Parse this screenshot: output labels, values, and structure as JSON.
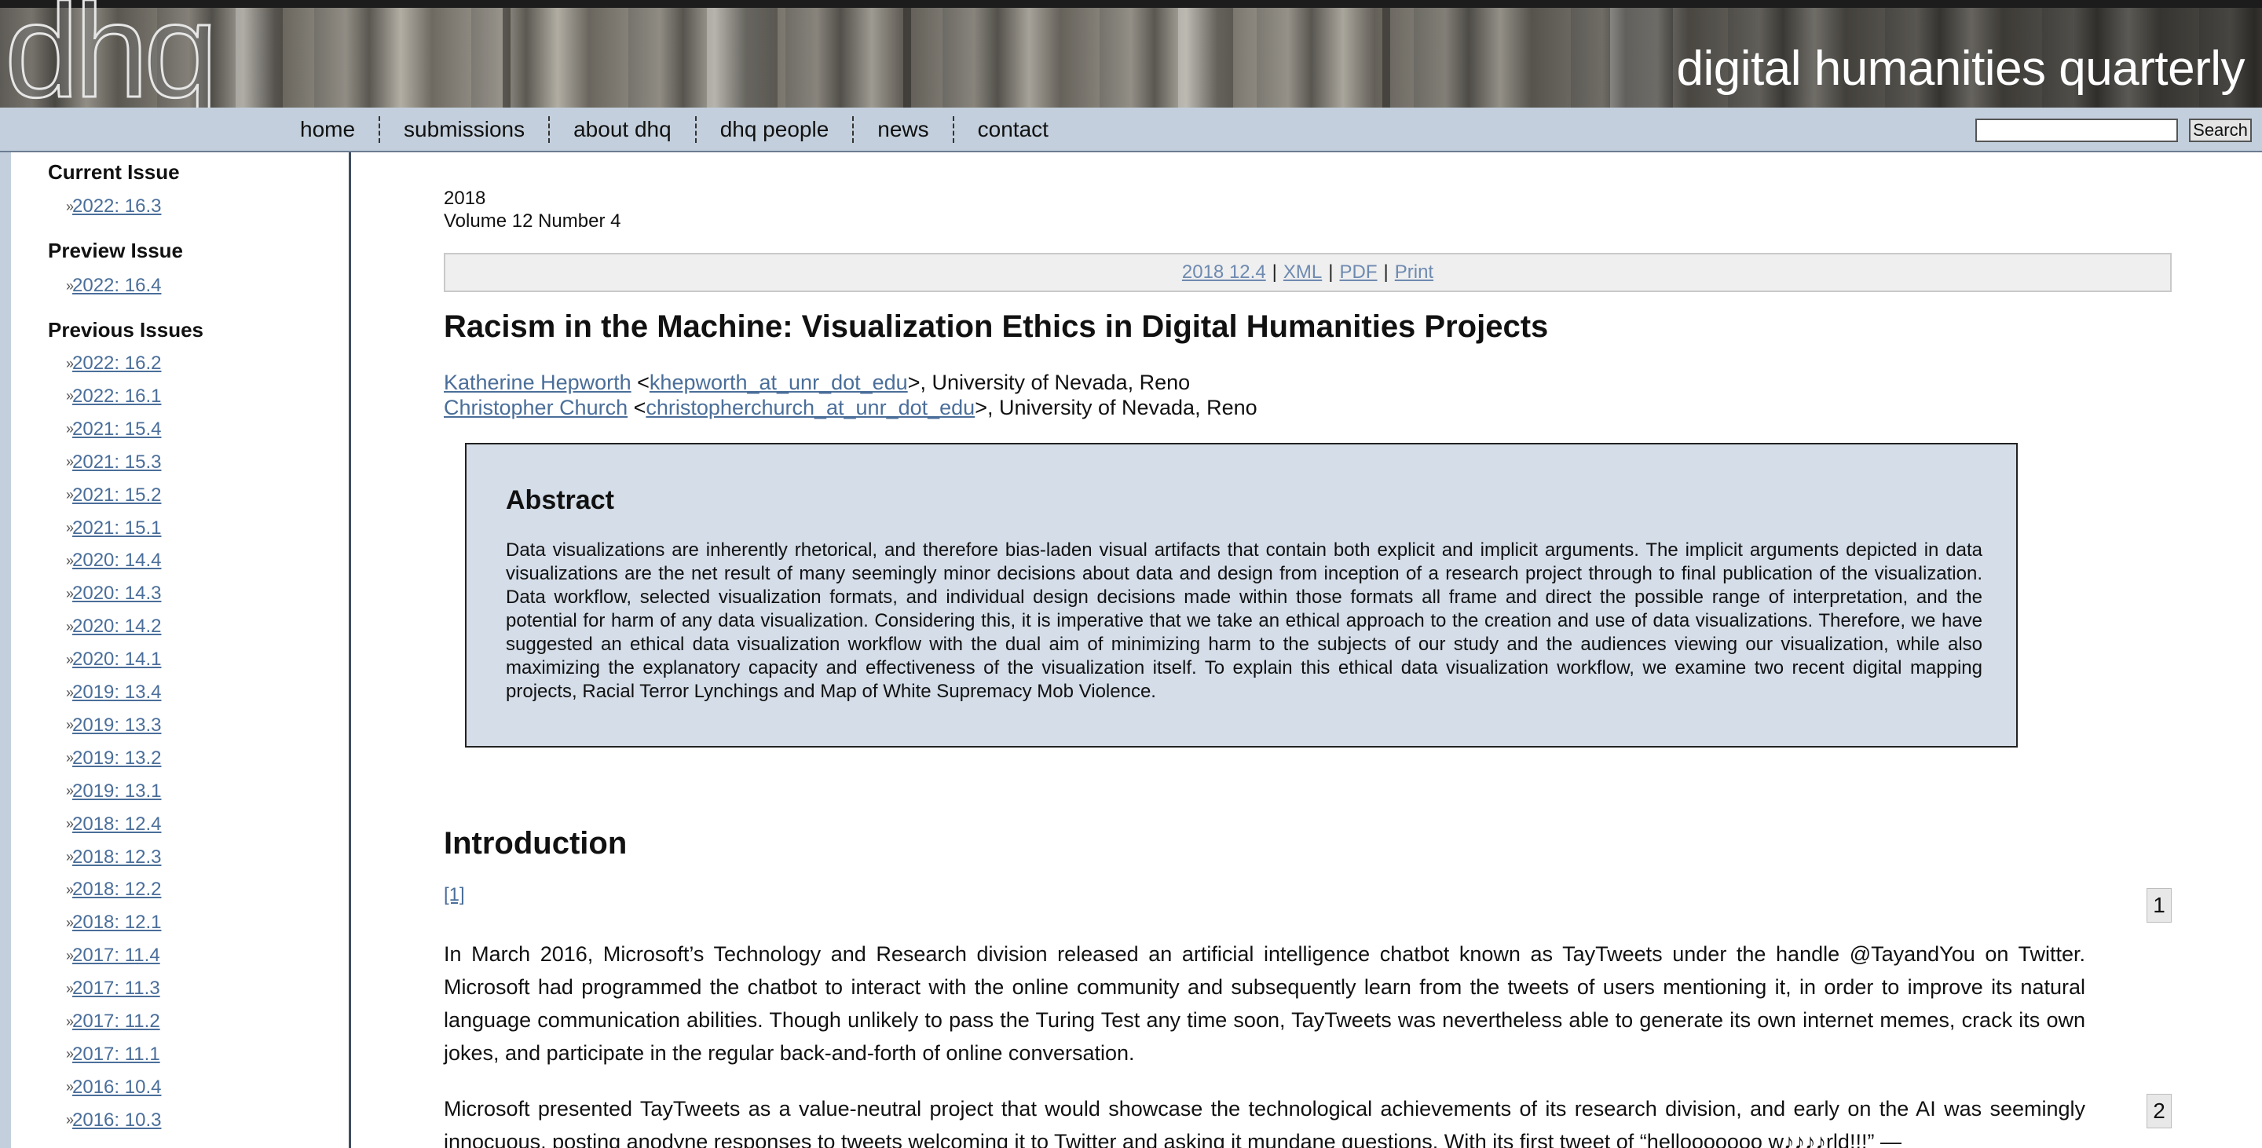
{
  "banner": {
    "logo": "dhq",
    "site_title": "digital humanities quarterly"
  },
  "nav": {
    "links": [
      "home",
      "submissions",
      "about dhq",
      "dhq people",
      "news",
      "contact"
    ],
    "search_placeholder": "",
    "search_button": "Search"
  },
  "sidebar": {
    "current_heading": "Current Issue",
    "current": "2022: 16.3",
    "preview_heading": "Preview Issue",
    "preview": "2022: 16.4",
    "previous_heading": "Previous Issues",
    "previous": [
      "2022: 16.2",
      "2022: 16.1",
      "2021: 15.4",
      "2021: 15.3",
      "2021: 15.2",
      "2021: 15.1",
      "2020: 14.4",
      "2020: 14.3",
      "2020: 14.2",
      "2020: 14.1",
      "2019: 13.4",
      "2019: 13.3",
      "2019: 13.2",
      "2019: 13.1",
      "2018: 12.4",
      "2018: 12.3",
      "2018: 12.2",
      "2018: 12.1",
      "2017: 11.4",
      "2017: 11.3",
      "2017: 11.2",
      "2017: 11.1",
      "2016: 10.4",
      "2016: 10.3"
    ]
  },
  "article": {
    "year": "2018",
    "volume": "Volume 12 Number 4",
    "toolbar": {
      "issue": "2018 12.4",
      "xml": "XML",
      "pdf": "PDF",
      "print": "Print"
    },
    "title": "Racism in the Machine: Visualization Ethics in Digital Humanities Projects",
    "authors": [
      {
        "name": "Katherine Hepworth",
        "email": "khepworth_at_unr_dot_edu",
        "affiliation": ", University of Nevada, Reno"
      },
      {
        "name": "Christopher Church",
        "email": "christopherchurch_at_unr_dot_edu",
        "affiliation": ", University of Nevada, Reno"
      }
    ],
    "abstract_heading": "Abstract",
    "abstract_text": "Data visualizations are inherently rhetorical, and therefore bias-laden visual artifacts that contain both explicit and implicit arguments. The implicit arguments depicted in data visualizations are the net result of many seemingly minor decisions about data and design from inception of a research project through to final publication of the visualization. Data workflow, selected visualization formats, and individual design decisions made within those formats all frame and direct the possible range of interpretation, and the potential for harm of any data visualization. Considering this, it is imperative that we take an ethical approach to the creation and use of data visualizations. Therefore, we have suggested an ethical data visualization workflow with the dual aim of minimizing harm to the subjects of our study and the audiences viewing our visualization, while also maximizing the explanatory capacity and effectiveness of the visualization itself. To explain this ethical data visualization workflow, we examine two recent digital mapping projects, Racial Terror Lynchings and Map of White Supremacy Mob Violence.",
    "intro_heading": "Introduction",
    "footnote_ref": "[1]",
    "paragraphs": [
      {
        "num": "1",
        "text": "In March 2016, Microsoft’s Technology and Research division released an artificial intelligence chatbot known as TayTweets under the handle @TayandYou on Twitter. Microsoft had programmed the chatbot to interact with the online community and subsequently learn from the tweets of users mentioning it, in order to improve its natural language communication abilities. Though unlikely to pass the Turing Test any time soon, TayTweets was nevertheless able to generate its own internet memes, crack its own jokes, and participate in the regular back-and-forth of online conversation."
      },
      {
        "num": "2",
        "text": "Microsoft presented TayTweets as a value-neutral project that would showcase the technological achievements of its research division, and early on the AI was seemingly innocuous, posting anodyne responses to tweets welcoming it to Twitter and asking it mundane questions. With its first tweet of “hellooooooo w♪♪♪♪rld!!!” —"
      }
    ]
  }
}
